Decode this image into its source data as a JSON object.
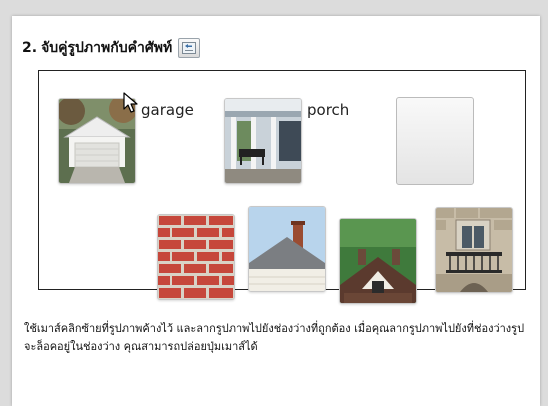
{
  "question": {
    "number": "2.",
    "title": "จับคู่รูปภาพกับคำศัพท์"
  },
  "words": {
    "garage": "garage",
    "porch": "porch"
  },
  "instructions": "ใช้เมาส์คลิกซ้ายที่รูปภาพค้างไว้ และลากรูปภาพไปยังช่องว่างที่ถูกต้อง เมื่อคุณลากรูปภาพไปยังที่ช่องว่างรูปจะล็อคอยู่ในช่องว่าง คุณสามารถปล่อยปุ่มเมาส์ได้",
  "images": [
    "garage",
    "porch",
    "brick-wall",
    "chimney",
    "dormer-roof",
    "balcony"
  ],
  "icons": {
    "help": "help-icon",
    "cursor": "mouse-cursor-icon"
  }
}
